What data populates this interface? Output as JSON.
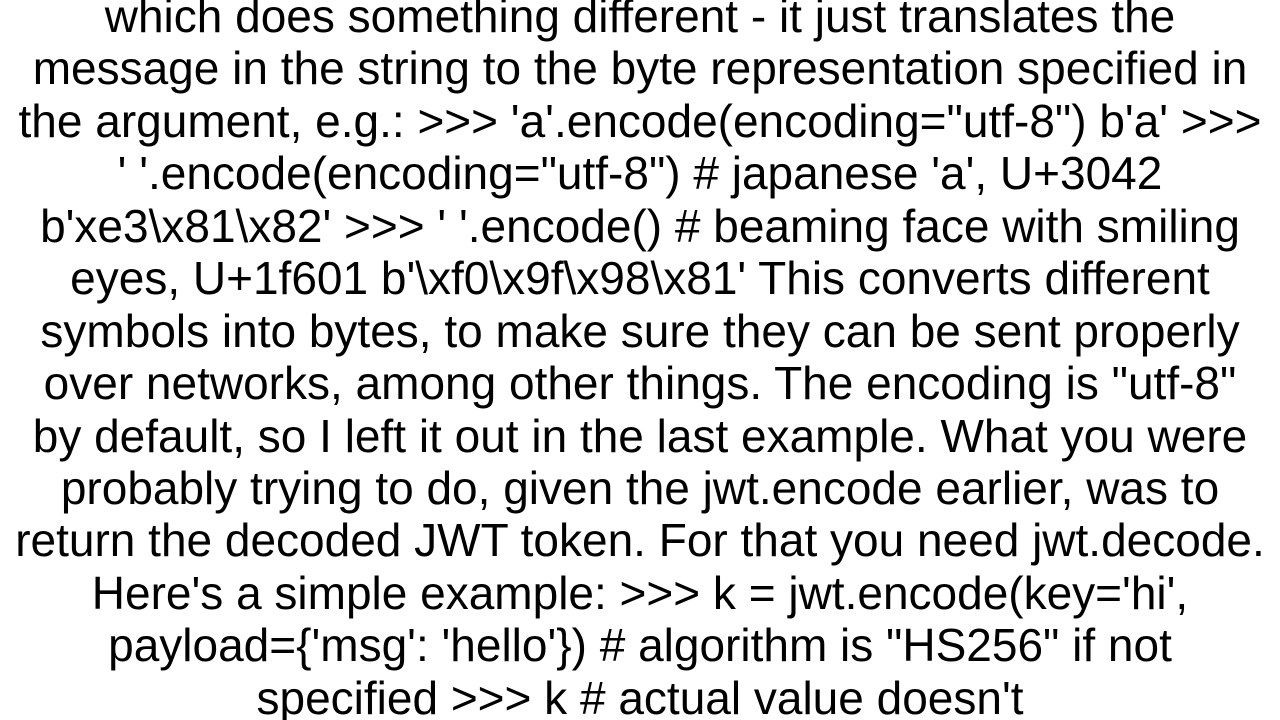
{
  "body": {
    "text": "which does something different - it just translates the message in the string to the byte representation specified in the argument, e.g.: >>> 'a'.encode(encoding=\"utf-8\") b'a' >>> '   '.encode(encoding=\"utf-8\")  # japanese 'a', U+3042 b'xe3\\x81\\x82' >>> '   '.encode() # beaming face with smiling eyes, U+1f601 b'\\xf0\\x9f\\x98\\x81'  This converts different symbols into bytes, to make sure they can be sent properly over networks, among other things. The encoding is \"utf-8\" by default, so I left it out in the last example. What you were probably trying to do, given the jwt.encode earlier, was to return the decoded JWT token. For that you need jwt.decode. Here's a simple example: >>> k = jwt.encode(key='hi', payload={'msg': 'hello'})  # algorithm is \"HS256\" if not specified >>> k  # actual value doesn't"
  }
}
